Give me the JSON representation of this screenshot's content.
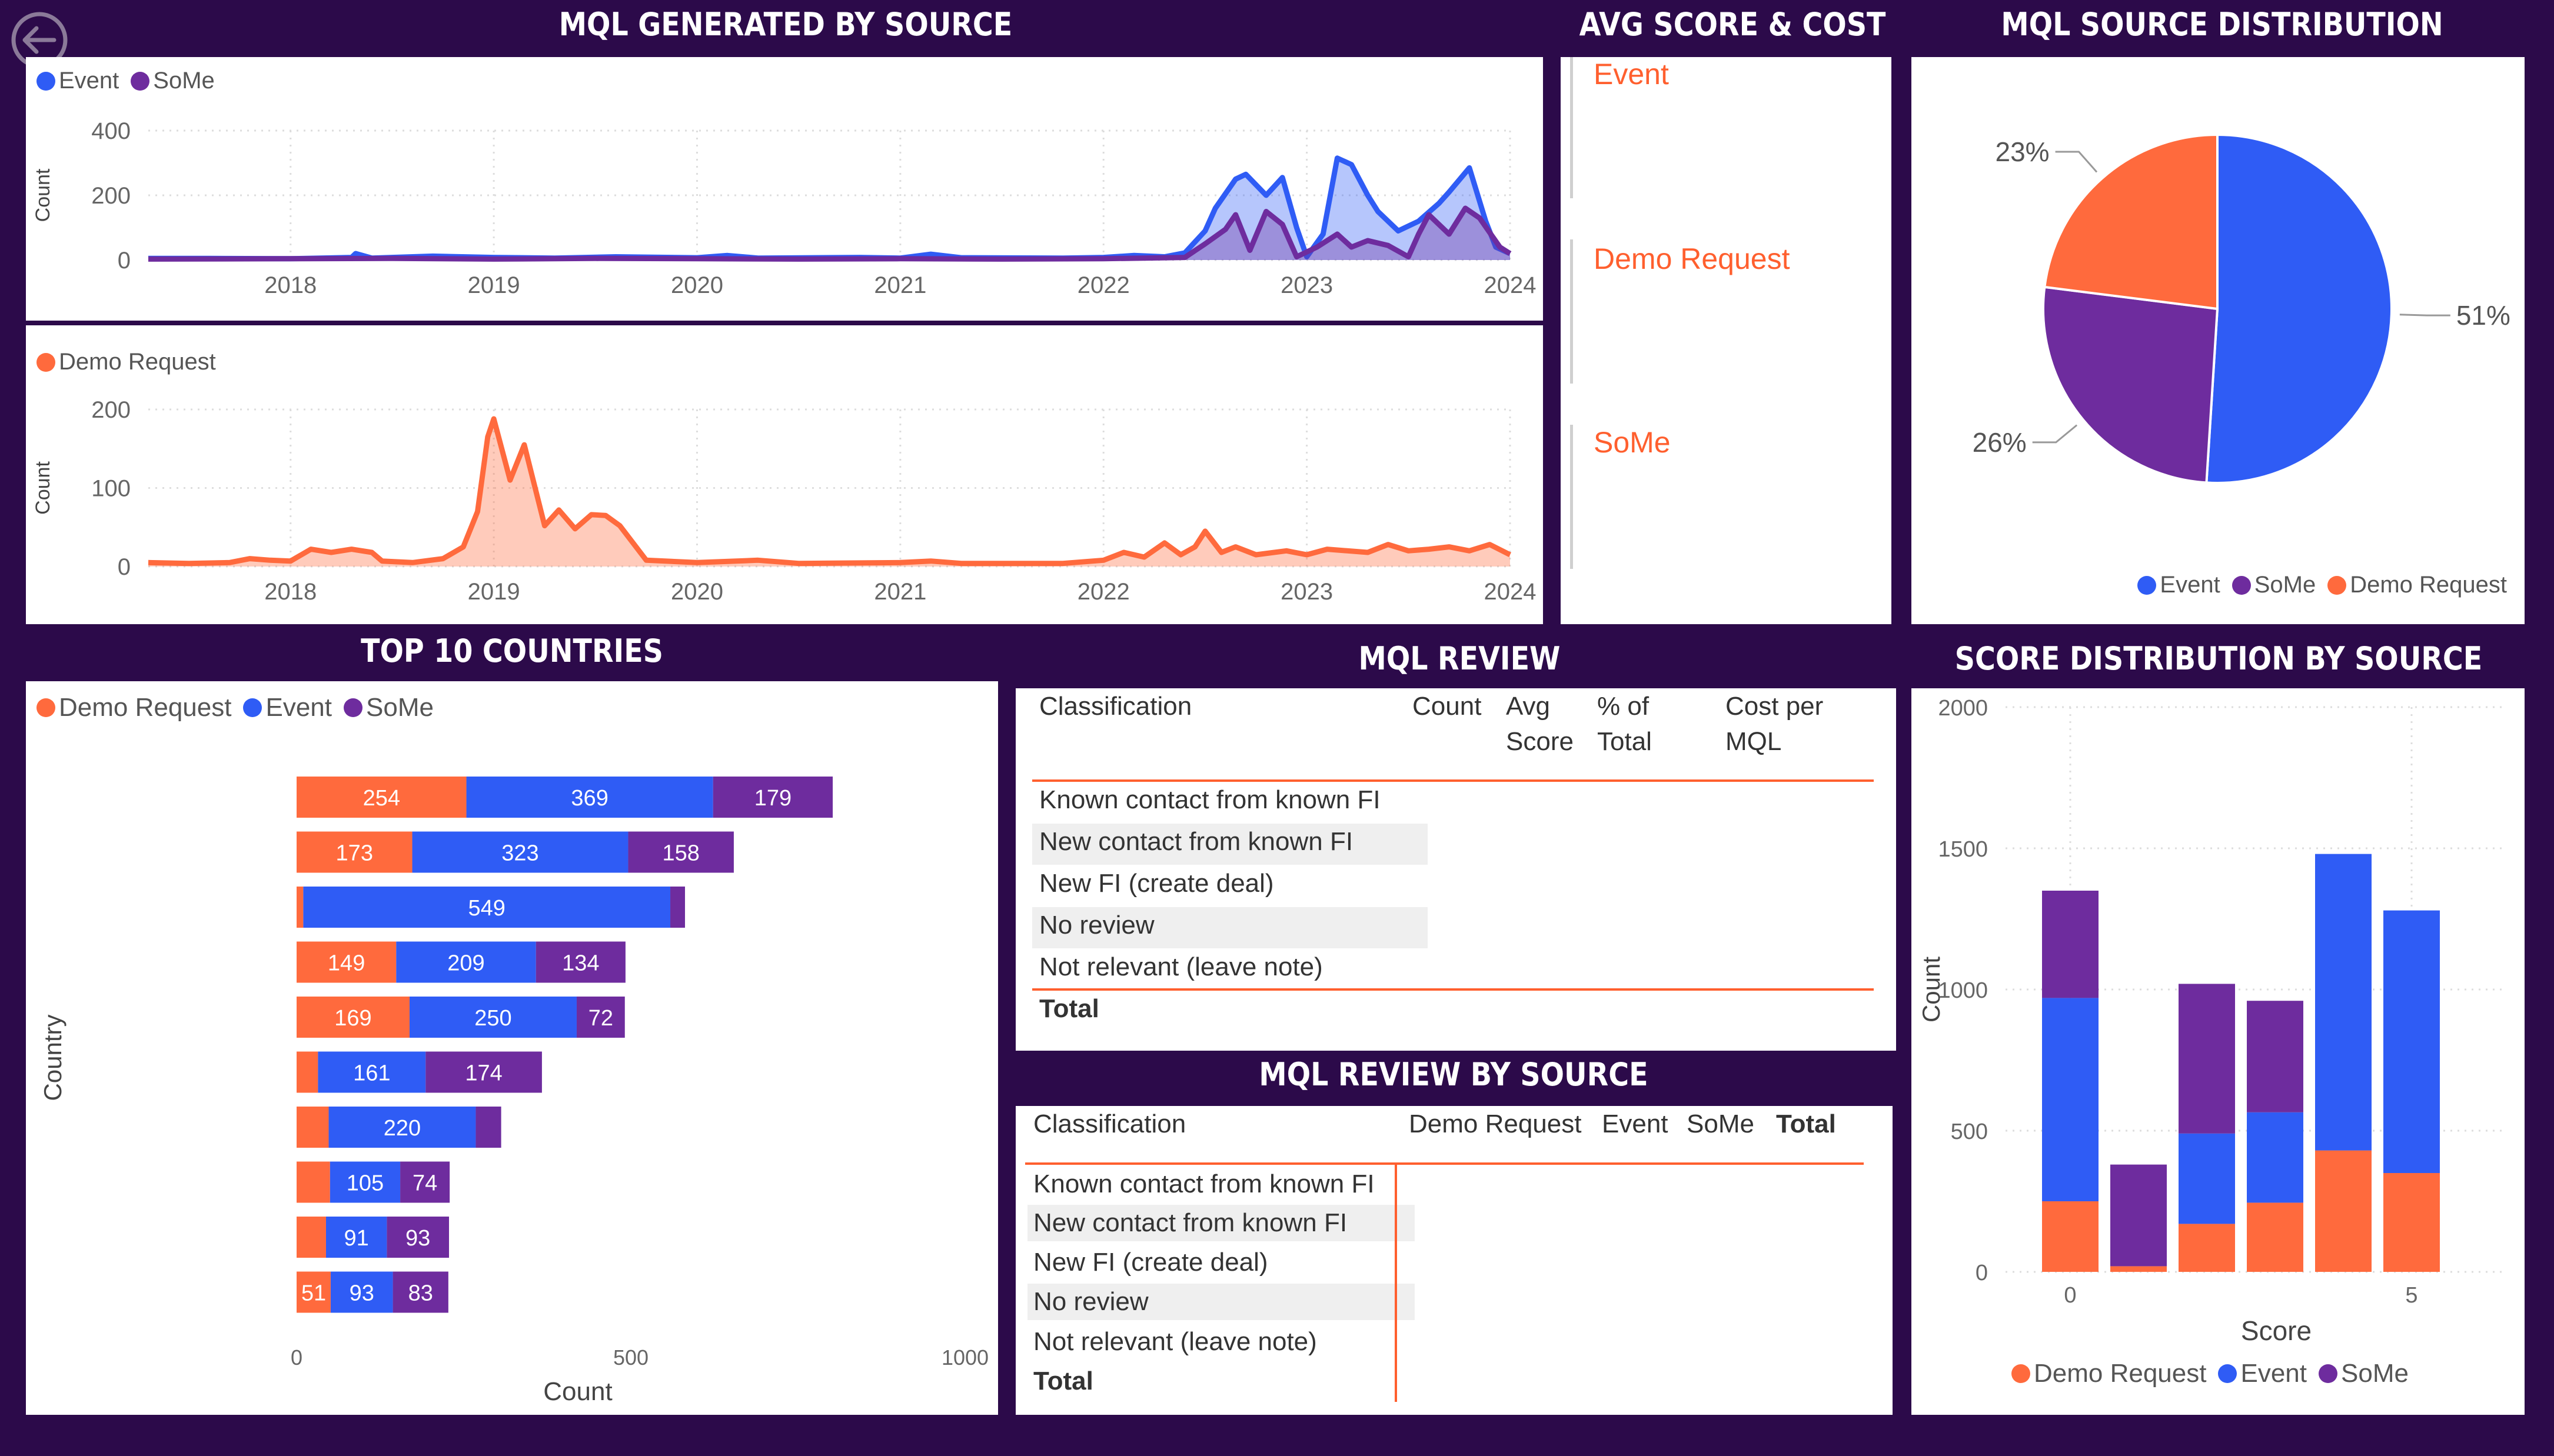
{
  "titles": {
    "mql_by_source": "MQL GENERATED BY SOURCE",
    "avg_score_cost": "AVG SCORE & COST",
    "mql_source_dist": "MQL SOURCE DISTRIBUTION",
    "top10": "TOP 10 COUNTRIES",
    "mql_review": "MQL REVIEW",
    "mql_review_by_source": "MQL REVIEW BY SOURCE",
    "score_dist": "SCORE DISTRIBUTION BY SOURCE"
  },
  "colors": {
    "event": "#2f5cf5",
    "some": "#6e2c9e",
    "demo": "#ff6a3d",
    "bg": "#2c0a4a"
  },
  "avg_panel": {
    "items": [
      "Event",
      "Demo Request",
      "SoMe"
    ]
  },
  "mql_review": {
    "headers": {
      "classification": "Classification",
      "count": "Count",
      "avg1": "Avg",
      "avg2": "Score",
      "pct1": "% of",
      "pct2": "Total",
      "cost1": "Cost per",
      "cost2": "MQL"
    },
    "rows": [
      "Known contact from known FI",
      "New contact from known FI",
      "New FI (create deal)",
      "No review",
      "Not relevant (leave note)"
    ],
    "total": "Total"
  },
  "mql_review_by_source": {
    "headers": {
      "classification": "Classification",
      "demo": "Demo Request",
      "event": "Event",
      "some": "SoMe",
      "total": "Total"
    },
    "rows": [
      "Known contact from known FI",
      "New contact from known FI",
      "New FI (create deal)",
      "No review",
      "Not relevant (leave note)"
    ],
    "total": "Total"
  },
  "chart_data": [
    {
      "id": "line_top",
      "type": "area",
      "legend": [
        "Event",
        "SoMe"
      ],
      "xlabel": "",
      "ylabel": "Count",
      "x_ticks": [
        "2018",
        "2019",
        "2020",
        "2021",
        "2022",
        "2023",
        "2024"
      ],
      "yticks": [
        0,
        200,
        400
      ],
      "ylim": [
        0,
        400
      ],
      "xlim": [
        2017.3,
        2024.0
      ],
      "series": [
        {
          "name": "Event",
          "points": [
            [
              2017.3,
              5
            ],
            [
              2017.6,
              5
            ],
            [
              2018.0,
              4
            ],
            [
              2018.3,
              8
            ],
            [
              2018.32,
              20
            ],
            [
              2018.4,
              6
            ],
            [
              2018.7,
              12
            ],
            [
              2019.0,
              8
            ],
            [
              2019.3,
              6
            ],
            [
              2019.6,
              10
            ],
            [
              2020.0,
              7
            ],
            [
              2020.15,
              14
            ],
            [
              2020.3,
              6
            ],
            [
              2020.8,
              8
            ],
            [
              2021.0,
              6
            ],
            [
              2021.15,
              18
            ],
            [
              2021.3,
              7
            ],
            [
              2021.8,
              6
            ],
            [
              2022.0,
              8
            ],
            [
              2022.15,
              14
            ],
            [
              2022.3,
              10
            ],
            [
              2022.4,
              22
            ],
            [
              2022.5,
              90
            ],
            [
              2022.55,
              160
            ],
            [
              2022.65,
              250
            ],
            [
              2022.7,
              265
            ],
            [
              2022.8,
              200
            ],
            [
              2022.88,
              255
            ],
            [
              2022.95,
              100
            ],
            [
              2023.0,
              10
            ],
            [
              2023.08,
              80
            ],
            [
              2023.15,
              315
            ],
            [
              2023.22,
              295
            ],
            [
              2023.3,
              200
            ],
            [
              2023.35,
              150
            ],
            [
              2023.45,
              90
            ],
            [
              2023.55,
              120
            ],
            [
              2023.65,
              175
            ],
            [
              2023.7,
              210
            ],
            [
              2023.8,
              285
            ],
            [
              2023.88,
              120
            ],
            [
              2023.93,
              40
            ],
            [
              2024.0,
              20
            ]
          ]
        },
        {
          "name": "SoMe",
          "points": [
            [
              2017.3,
              3
            ],
            [
              2018.0,
              4
            ],
            [
              2018.5,
              5
            ],
            [
              2019.0,
              3
            ],
            [
              2019.5,
              5
            ],
            [
              2020.0,
              4
            ],
            [
              2020.5,
              3
            ],
            [
              2021.0,
              4
            ],
            [
              2021.5,
              3
            ],
            [
              2022.0,
              4
            ],
            [
              2022.4,
              8
            ],
            [
              2022.5,
              50
            ],
            [
              2022.6,
              95
            ],
            [
              2022.65,
              140
            ],
            [
              2022.72,
              30
            ],
            [
              2022.8,
              150
            ],
            [
              2022.88,
              110
            ],
            [
              2022.95,
              10
            ],
            [
              2023.05,
              40
            ],
            [
              2023.15,
              80
            ],
            [
              2023.22,
              40
            ],
            [
              2023.3,
              60
            ],
            [
              2023.4,
              45
            ],
            [
              2023.5,
              10
            ],
            [
              2023.55,
              80
            ],
            [
              2023.6,
              140
            ],
            [
              2023.7,
              80
            ],
            [
              2023.78,
              160
            ],
            [
              2023.85,
              130
            ],
            [
              2023.95,
              40
            ],
            [
              2024.0,
              20
            ]
          ]
        }
      ]
    },
    {
      "id": "line_bottom",
      "type": "area",
      "legend": [
        "Demo Request"
      ],
      "xlabel": "",
      "ylabel": "Count",
      "x_ticks": [
        "2018",
        "2019",
        "2020",
        "2021",
        "2022",
        "2023",
        "2024"
      ],
      "yticks": [
        0,
        100,
        200
      ],
      "ylim": [
        0,
        200
      ],
      "xlim": [
        2017.3,
        2024.0
      ],
      "series": [
        {
          "name": "Demo Request",
          "points": [
            [
              2017.3,
              5
            ],
            [
              2017.5,
              4
            ],
            [
              2017.7,
              5
            ],
            [
              2017.8,
              10
            ],
            [
              2017.9,
              8
            ],
            [
              2018.0,
              7
            ],
            [
              2018.1,
              22
            ],
            [
              2018.2,
              18
            ],
            [
              2018.3,
              22
            ],
            [
              2018.4,
              18
            ],
            [
              2018.45,
              7
            ],
            [
              2018.6,
              5
            ],
            [
              2018.75,
              10
            ],
            [
              2018.85,
              25
            ],
            [
              2018.92,
              70
            ],
            [
              2018.97,
              165
            ],
            [
              2019.0,
              188
            ],
            [
              2019.08,
              110
            ],
            [
              2019.15,
              155
            ],
            [
              2019.25,
              52
            ],
            [
              2019.32,
              72
            ],
            [
              2019.4,
              48
            ],
            [
              2019.48,
              66
            ],
            [
              2019.55,
              65
            ],
            [
              2019.62,
              52
            ],
            [
              2019.75,
              8
            ],
            [
              2020.0,
              5
            ],
            [
              2020.3,
              8
            ],
            [
              2020.5,
              4
            ],
            [
              2021.0,
              5
            ],
            [
              2021.15,
              7
            ],
            [
              2021.3,
              4
            ],
            [
              2021.8,
              4
            ],
            [
              2022.0,
              8
            ],
            [
              2022.1,
              18
            ],
            [
              2022.2,
              12
            ],
            [
              2022.3,
              30
            ],
            [
              2022.38,
              15
            ],
            [
              2022.45,
              25
            ],
            [
              2022.5,
              45
            ],
            [
              2022.58,
              18
            ],
            [
              2022.65,
              25
            ],
            [
              2022.75,
              15
            ],
            [
              2022.9,
              20
            ],
            [
              2023.0,
              15
            ],
            [
              2023.1,
              22
            ],
            [
              2023.3,
              18
            ],
            [
              2023.4,
              28
            ],
            [
              2023.5,
              20
            ],
            [
              2023.6,
              22
            ],
            [
              2023.7,
              25
            ],
            [
              2023.8,
              20
            ],
            [
              2023.9,
              28
            ],
            [
              2024.0,
              15
            ]
          ]
        }
      ]
    },
    {
      "id": "pie",
      "type": "pie",
      "legend": [
        "Event",
        "SoMe",
        "Demo Request"
      ],
      "slices": [
        {
          "name": "Event",
          "value": 51,
          "label": "51%"
        },
        {
          "name": "SoMe",
          "value": 26,
          "label": "26%"
        },
        {
          "name": "Demo Request",
          "value": 23,
          "label": "23%"
        }
      ]
    },
    {
      "id": "top10",
      "type": "bar",
      "orientation": "horizontal",
      "stacked": true,
      "legend": [
        "Demo Request",
        "Event",
        "SoMe"
      ],
      "xlabel": "Count",
      "ylabel": "Country",
      "xticks": [
        0,
        500,
        1000
      ],
      "xlim": [
        0,
        1000
      ],
      "rows": [
        {
          "demo": 254,
          "event": 369,
          "some": 179,
          "labels": [
            "254",
            "369",
            "179"
          ]
        },
        {
          "demo": 173,
          "event": 323,
          "some": 158,
          "labels": [
            "173",
            "323",
            "158"
          ]
        },
        {
          "demo": 10,
          "event": 549,
          "some": 22,
          "labels": [
            "",
            "549",
            ""
          ]
        },
        {
          "demo": 149,
          "event": 209,
          "some": 134,
          "labels": [
            "149",
            "209",
            "134"
          ]
        },
        {
          "demo": 169,
          "event": 250,
          "some": 72,
          "labels": [
            "169",
            "250",
            "72"
          ]
        },
        {
          "demo": 32,
          "event": 161,
          "some": 174,
          "labels": [
            "",
            "161",
            "174"
          ]
        },
        {
          "demo": 48,
          "event": 220,
          "some": 38,
          "labels": [
            "",
            "220",
            ""
          ]
        },
        {
          "demo": 50,
          "event": 105,
          "some": 74,
          "labels": [
            "",
            "105",
            "74"
          ]
        },
        {
          "demo": 44,
          "event": 91,
          "some": 93,
          "labels": [
            "",
            "91",
            "93"
          ]
        },
        {
          "demo": 51,
          "event": 93,
          "some": 83,
          "labels": [
            "51",
            "93",
            "83"
          ]
        }
      ]
    },
    {
      "id": "score_dist",
      "type": "bar",
      "stacked": true,
      "legend": [
        "Demo Request",
        "Event",
        "SoMe"
      ],
      "xlabel": "Score",
      "ylabel": "Count",
      "xticks": [
        "0",
        "5"
      ],
      "yticks": [
        0,
        500,
        1000,
        1500,
        2000
      ],
      "ylim": [
        0,
        2000
      ],
      "bars": [
        {
          "score": 0,
          "demo": 250,
          "event": 720,
          "some": 380
        },
        {
          "score": 1,
          "demo": 20,
          "event": 0,
          "some": 360
        },
        {
          "score": 2,
          "demo": 170,
          "event": 320,
          "some": 530
        },
        {
          "score": 3,
          "demo": 245,
          "event": 320,
          "some": 395
        },
        {
          "score": 4,
          "demo": 430,
          "event": 1050,
          "some": 0
        },
        {
          "score": 5,
          "demo": 350,
          "event": 930,
          "some": 0
        }
      ]
    }
  ]
}
